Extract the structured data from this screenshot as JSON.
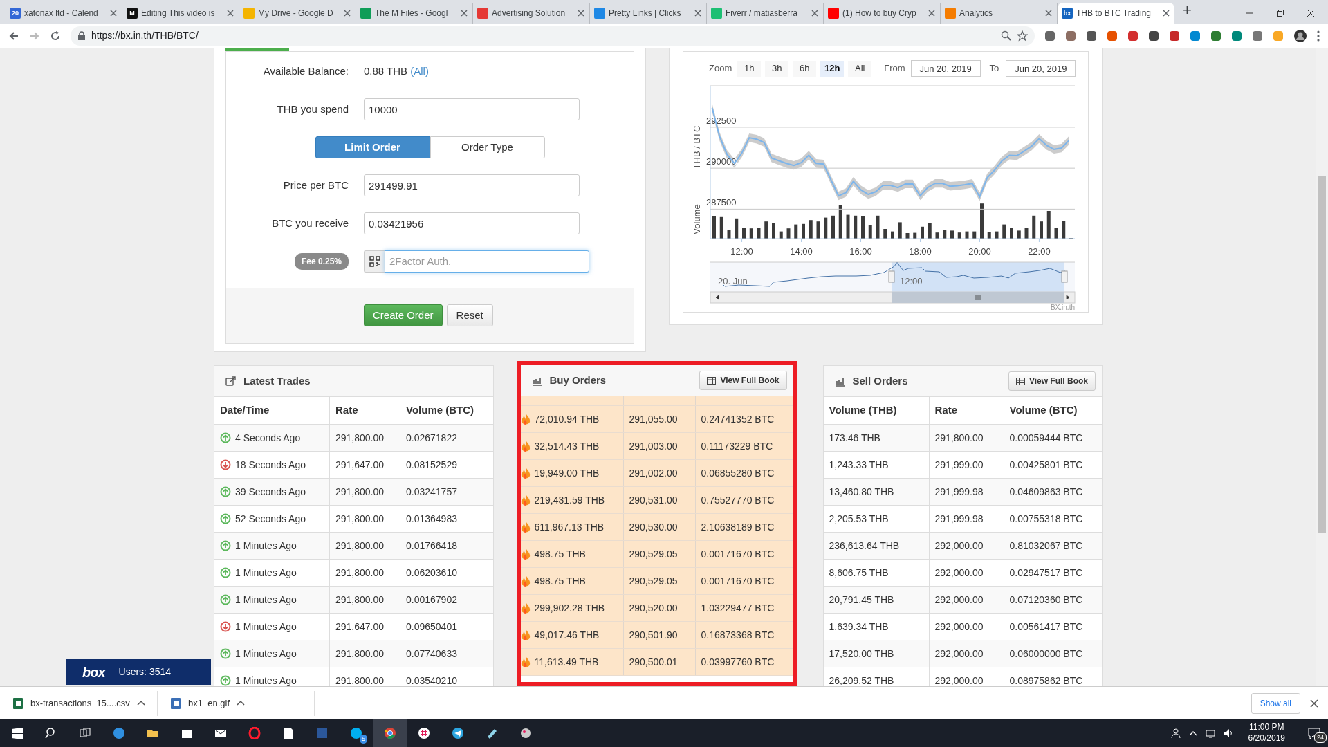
{
  "browser": {
    "tabs": [
      {
        "title": "xatonax ltd - Calend",
        "icon_text": "20",
        "color": "#3367d6",
        "selected": false
      },
      {
        "title": "Editing This video is",
        "icon_text": "M",
        "color": "#111111",
        "selected": false
      },
      {
        "title": "My Drive - Google D",
        "color": "#f4b400",
        "selected": false
      },
      {
        "title": "The M Files - Googl",
        "color": "#0f9d58",
        "selected": false
      },
      {
        "title": "Advertising Solution",
        "color": "#e53935",
        "selected": false
      },
      {
        "title": "Pretty Links | Clicks",
        "color": "#1e88e5",
        "selected": false
      },
      {
        "title": "Fiverr / matiasberra",
        "color": "#1dbf73",
        "selected": false
      },
      {
        "title": "(1) How to buy Cryp",
        "color": "#ff0000",
        "selected": false
      },
      {
        "title": "Analytics",
        "color": "#f57c00",
        "selected": false
      },
      {
        "title": "THB to BTC Trading",
        "icon_text": "bx",
        "color": "#1565c0",
        "selected": true
      }
    ],
    "new_tab": "+",
    "url": "https://bx.in.th/THB/BTC/"
  },
  "order_form": {
    "balance_label": "Available Balance:",
    "balance_value": "0.88 THB",
    "balance_link": "(All)",
    "spend": {
      "label": "THB you spend",
      "value": "10000"
    },
    "order_types": [
      {
        "label": "Limit Order",
        "selected": true
      },
      {
        "label": "Order Type",
        "selected": false
      }
    ],
    "price": {
      "label": "Price per BTC",
      "value": "291499.91"
    },
    "receive": {
      "label": "BTC you receive",
      "value": "0.03421956"
    },
    "fee": "Fee 0.25%",
    "auth": {
      "placeholder": "2Factor Auth."
    },
    "buttons": [
      "Create Order",
      "Reset"
    ]
  },
  "chart": {
    "zoom_label": "Zoom",
    "zoom_options": [
      {
        "label": "1h",
        "selected": false
      },
      {
        "label": "3h",
        "selected": false
      },
      {
        "label": "6h",
        "selected": false
      },
      {
        "label": "12h",
        "selected": true
      },
      {
        "label": "All",
        "selected": false
      }
    ],
    "from_label": "From",
    "from": "Jun 20, 2019",
    "to_label": "To",
    "to": "Jun 20, 2019",
    "volume_label": "Volume",
    "navigator_labels": [
      "20. Jun",
      "12:00"
    ],
    "credits": "BX.in.th",
    "chart_data": {
      "type": "line",
      "ylabel": "THB / BTC",
      "x": [
        11,
        11.25,
        11.5,
        11.75,
        12,
        12.25,
        12.5,
        12.75,
        13,
        13.25,
        13.5,
        13.75,
        14,
        14.25,
        14.5,
        14.75,
        15,
        15.25,
        15.5,
        15.75,
        16,
        16.25,
        16.5,
        16.75,
        17,
        17.25,
        17.5,
        17.75,
        18,
        18.25,
        18.5,
        18.75,
        19,
        19.25,
        19.5,
        19.75,
        20,
        20.25,
        20.5,
        20.75,
        21,
        21.25,
        21.5,
        21.75,
        22,
        22.25,
        22.5,
        22.75,
        23
      ],
      "grid": true,
      "series": [
        {
          "color": "#7cb5ec",
          "values": [
            293680,
            291940,
            290840,
            290290,
            290930,
            291860,
            291770,
            291570,
            290620,
            290450,
            290290,
            290170,
            290340,
            290790,
            290290,
            290250,
            289270,
            288310,
            288510,
            289200,
            288680,
            288400,
            288560,
            288950,
            288950,
            288820,
            289040,
            289040,
            288310,
            288820,
            289070,
            289070,
            288900,
            288930,
            288990,
            289070,
            288260,
            289410,
            289880,
            290450,
            290790,
            290760,
            291050,
            291350,
            291810,
            291390,
            291150,
            291230,
            291690
          ]
        }
      ],
      "xlim": [
        10.94,
        23.2
      ],
      "ylim": [
        285700,
        295030
      ],
      "xticks": [
        {
          "value": 12,
          "label": "12:00"
        },
        {
          "value": 14,
          "label": "14:00"
        },
        {
          "value": 16,
          "label": "16:00"
        },
        {
          "value": 18,
          "label": "18:00"
        },
        {
          "value": 20,
          "label": "20:00"
        },
        {
          "value": 22,
          "label": "22:00"
        }
      ],
      "yticks": [
        287500,
        290000,
        292500
      ]
    }
  },
  "latest_trades": {
    "title": "Latest Trades",
    "columns": [
      "Date/Time",
      "Rate",
      "Volume (BTC)"
    ],
    "rows": [
      {
        "kind": "up",
        "time": "4 Seconds Ago",
        "rate": "291,800.00",
        "volume": "0.02671822"
      },
      {
        "kind": "down",
        "time": "18 Seconds Ago",
        "rate": "291,647.00",
        "volume": "0.08152529"
      },
      {
        "kind": "up",
        "time": "39 Seconds Ago",
        "rate": "291,800.00",
        "volume": "0.03241757"
      },
      {
        "kind": "up",
        "time": "52 Seconds Ago",
        "rate": "291,800.00",
        "volume": "0.01364983"
      },
      {
        "kind": "up",
        "time": "1 Minutes Ago",
        "rate": "291,800.00",
        "volume": "0.01766418"
      },
      {
        "kind": "up",
        "time": "1 Minutes Ago",
        "rate": "291,800.00",
        "volume": "0.06203610"
      },
      {
        "kind": "up",
        "time": "1 Minutes Ago",
        "rate": "291,800.00",
        "volume": "0.00167902"
      },
      {
        "kind": "down",
        "time": "1 Minutes Ago",
        "rate": "291,647.00",
        "volume": "0.09650401"
      },
      {
        "kind": "up",
        "time": "1 Minutes Ago",
        "rate": "291,800.00",
        "volume": "0.07740633"
      },
      {
        "kind": "up",
        "time": "1 Minutes Ago",
        "rate": "291,800.00",
        "volume": "0.03540210"
      }
    ]
  },
  "buy_orders": {
    "title": "Buy Orders",
    "button": "View Full Book",
    "rows": [
      {
        "thb": "72,010.94 THB",
        "rate": "291,055.00",
        "btc": "0.24741352 BTC"
      },
      {
        "thb": "32,514.43 THB",
        "rate": "291,003.00",
        "btc": "0.11173229 BTC"
      },
      {
        "thb": "19,949.00 THB",
        "rate": "291,002.00",
        "btc": "0.06855280 BTC"
      },
      {
        "thb": "219,431.59 THB",
        "rate": "290,531.00",
        "btc": "0.75527770 BTC"
      },
      {
        "thb": "611,967.13 THB",
        "rate": "290,530.00",
        "btc": "2.10638189 BTC"
      },
      {
        "thb": "498.75 THB",
        "rate": "290,529.05",
        "btc": "0.00171670 BTC"
      },
      {
        "thb": "498.75 THB",
        "rate": "290,529.05",
        "btc": "0.00171670 BTC"
      },
      {
        "thb": "299,902.28 THB",
        "rate": "290,520.00",
        "btc": "1.03229477 BTC"
      },
      {
        "thb": "49,017.46 THB",
        "rate": "290,501.90",
        "btc": "0.16873368 BTC"
      },
      {
        "thb": "11,613.49 THB",
        "rate": "290,500.01",
        "btc": "0.03997760 BTC"
      }
    ]
  },
  "sell_orders": {
    "title": "Sell Orders",
    "button": "View Full Book",
    "columns": [
      "Volume (THB)",
      "Rate",
      "Volume (BTC)"
    ],
    "rows": [
      {
        "thb": "173.46 THB",
        "rate": "291,800.00",
        "btc": "0.00059444 BTC"
      },
      {
        "thb": "1,243.33 THB",
        "rate": "291,999.00",
        "btc": "0.00425801 BTC"
      },
      {
        "thb": "13,460.80 THB",
        "rate": "291,999.98",
        "btc": "0.04609863 BTC"
      },
      {
        "thb": "2,205.53 THB",
        "rate": "291,999.98",
        "btc": "0.00755318 BTC"
      },
      {
        "thb": "236,613.64 THB",
        "rate": "292,000.00",
        "btc": "0.81032067 BTC"
      },
      {
        "thb": "8,606.75 THB",
        "rate": "292,000.00",
        "btc": "0.02947517 BTC"
      },
      {
        "thb": "20,791.45 THB",
        "rate": "292,000.00",
        "btc": "0.07120360 BTC"
      },
      {
        "thb": "1,639.34 THB",
        "rate": "292,000.00",
        "btc": "0.00561417 BTC"
      },
      {
        "thb": "17,520.00 THB",
        "rate": "292,000.00",
        "btc": "0.06000000 BTC"
      },
      {
        "thb": "26,209.52 THB",
        "rate": "292,000.00",
        "btc": "0.08975862 BTC"
      }
    ]
  },
  "users_badge": {
    "logo": "box",
    "text": "Users: 3514"
  },
  "downloads": {
    "items": [
      {
        "name": "bx-transactions_15....csv",
        "color": "#1d7044"
      },
      {
        "name": "bx1_en.gif",
        "color": "#3b6fb6"
      }
    ],
    "show_all": "Show all"
  },
  "taskbar": {
    "skype_badge": "5",
    "time": "11:00 PM",
    "date": "6/20/2019",
    "notifications": "24"
  }
}
